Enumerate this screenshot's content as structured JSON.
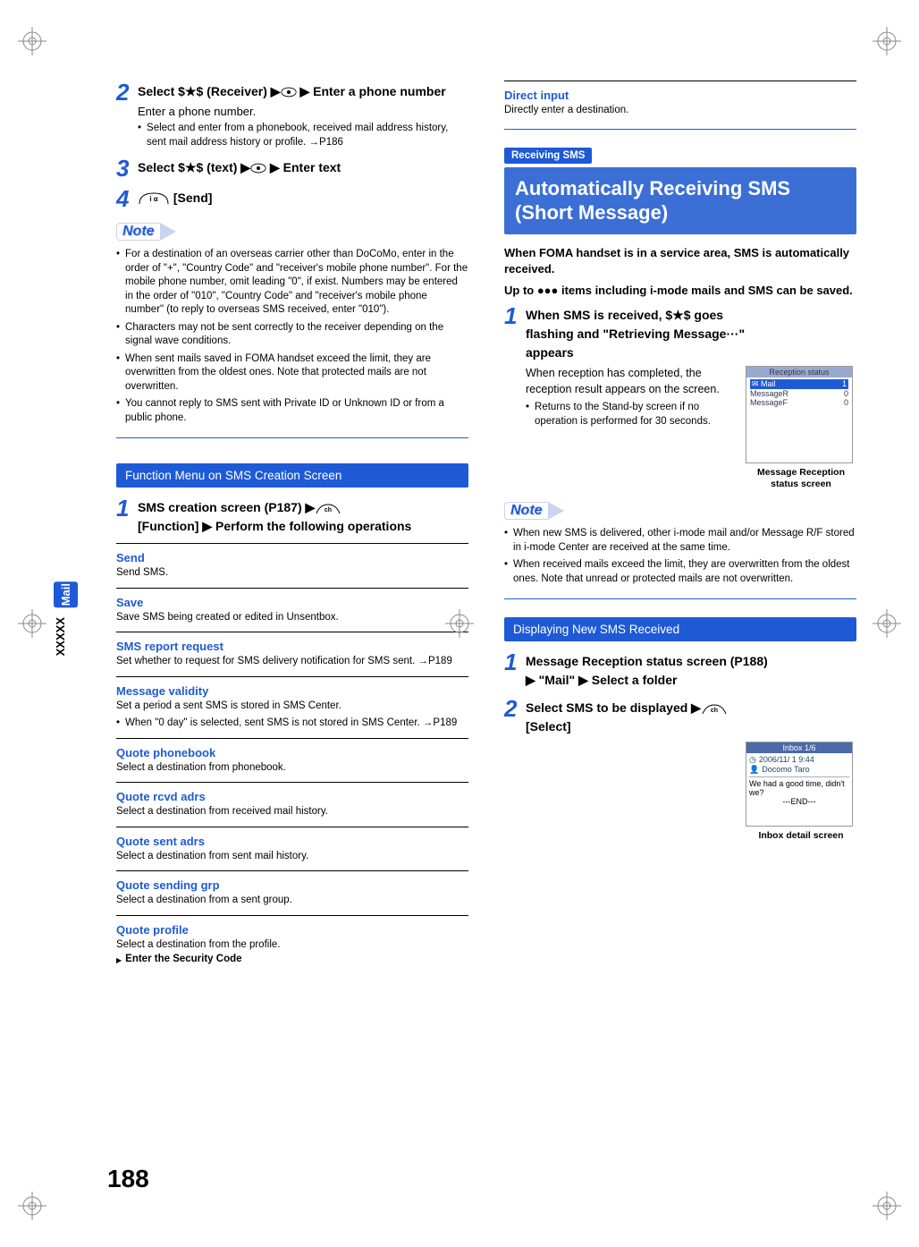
{
  "page_number": "188",
  "side_tab": {
    "label": "Mail",
    "sub": "XXXXX"
  },
  "left": {
    "steps": [
      {
        "num": "2",
        "title_parts": [
          "Select $",
          "$ (Receiver) ",
          " ",
          " Enter a phone number"
        ],
        "desc": "Enter a phone number.",
        "bullets": [
          "Select and enter from a phonebook, received mail address history, sent mail address history or profile. →P186"
        ]
      },
      {
        "num": "3",
        "title_parts": [
          "Select $",
          "$ (text) ",
          " ",
          " Enter text"
        ]
      },
      {
        "num": "4",
        "title_parts": [
          " [Send]"
        ]
      }
    ],
    "note_label": "Note",
    "note_bullets": [
      "For a destination of an overseas carrier other than DoCoMo, enter in the order of \"+\", \"Country Code\" and \"receiver's mobile phone number\". For the mobile phone number, omit leading \"0\", if exist. Numbers may be entered in the order of \"010\", \"Country Code\" and \"receiver's mobile phone number\" (to reply to overseas SMS received, enter \"010\").",
      "Characters may not be sent correctly to the receiver depending on the signal wave conditions.",
      "When sent mails saved in FOMA handset exceed the limit, they are overwritten from the oldest ones. Note that protected mails are not overwritten.",
      "You cannot reply to SMS sent with Private ID or Unknown ID or from a public phone."
    ],
    "function_menu_header": "Function Menu on SMS Creation Screen",
    "fn_step": {
      "num": "1",
      "title": "SMS creation screen (P187) ",
      "title2": "[Function] ",
      "title3": " Perform the following operations"
    },
    "functions": [
      {
        "title": "Send",
        "desc": "Send SMS."
      },
      {
        "title": "Save",
        "desc": "Save SMS being created or edited in Unsentbox."
      },
      {
        "title": "SMS report request",
        "desc": "Set whether to request for SMS delivery notification for SMS sent. →P189"
      },
      {
        "title": "Message validity",
        "desc": "Set a period a sent SMS is stored in SMS Center.",
        "sub": "When \"0 day\" is selected, sent SMS is not stored in SMS Center. →P189"
      },
      {
        "title": "Quote phonebook",
        "desc": "Select a destination from phonebook."
      },
      {
        "title": "Quote rcvd adrs",
        "desc": "Select a destination from received mail history."
      },
      {
        "title": "Quote sent adrs",
        "desc": "Select a destination from sent mail history."
      },
      {
        "title": "Quote sending grp",
        "desc": "Select a destination from a sent group."
      },
      {
        "title": "Quote profile",
        "desc": "Select a destination from the profile.",
        "extra": "Enter the Security Code"
      }
    ]
  },
  "right": {
    "direct_input": {
      "title": "Direct input",
      "desc": "Directly enter a destination."
    },
    "receiving_tag": "Receiving SMS",
    "big_header": "Automatically Receiving SMS (Short Message)",
    "intro1": "When FOMA handset is in a service area, SMS is automatically received.",
    "intro2": "Up to ●●● items including i-mode mails and SMS can be saved.",
    "step1": {
      "num": "1",
      "line1a": "When SMS is received, $",
      "line1b": "$ goes",
      "line2": "flashing and \"Retrieving Message···\"",
      "line3": "appears",
      "desc": "When reception has completed, the reception result appears on the screen.",
      "bullet": "Returns to the Stand-by screen if no operation is performed for 30 seconds."
    },
    "screen1": {
      "title": "Reception status",
      "rows": [
        {
          "label": "Mail",
          "val": "1"
        },
        {
          "label": "MessageR",
          "val": "0"
        },
        {
          "label": "MessageF",
          "val": "0"
        }
      ],
      "caption": "Message Reception status screen"
    },
    "note_label": "Note",
    "note_bullets": [
      "When new SMS is delivered, other i-mode mail and/or Message R/F stored in i-mode Center are received at the same time.",
      "When received mails exceed the limit, they are overwritten from the oldest ones. Note that unread or protected mails are not overwritten."
    ],
    "display_header": "Displaying New SMS Received",
    "dstep1": {
      "num": "1",
      "line1": "Message Reception status screen (P188)",
      "line2a": " \"Mail\" ",
      "line2b": " Select a folder"
    },
    "dstep2": {
      "num": "2",
      "line1": "Select SMS to be displayed ",
      "line2": "[Select]"
    },
    "screen2": {
      "bar": "Inbox        1/6",
      "l1": "2006/11/ 1 9:44",
      "l2": "Docomo Taro",
      "l3": "We had a good time, didn't we?",
      "l4": "---END---",
      "caption": "Inbox detail screen"
    }
  }
}
